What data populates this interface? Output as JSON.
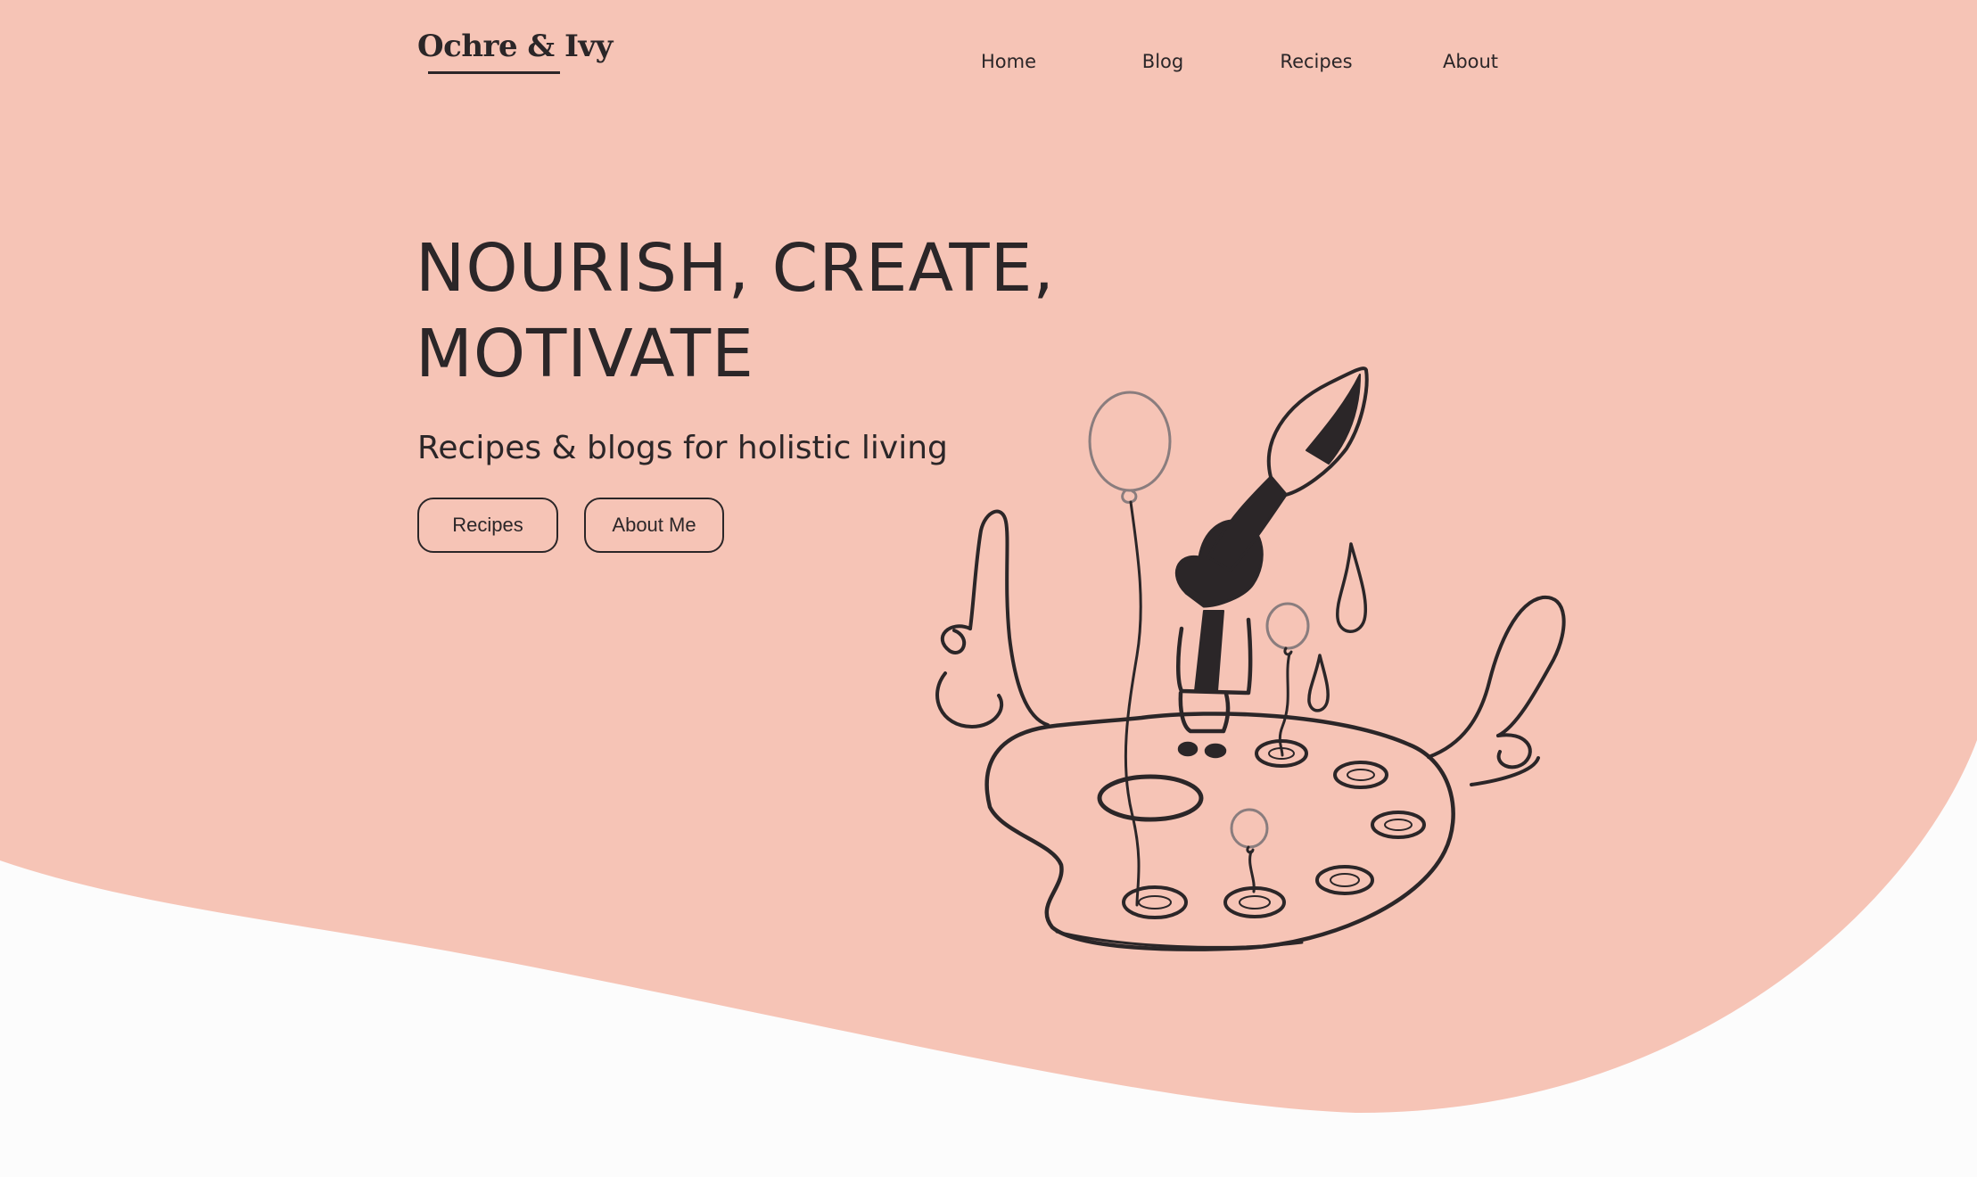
{
  "brand": {
    "logo_text": "Ochre & Ivy"
  },
  "nav": {
    "items": [
      {
        "label": "Home"
      },
      {
        "label": "Blog"
      },
      {
        "label": "Recipes"
      },
      {
        "label": "About"
      }
    ]
  },
  "hero": {
    "title_line1": "NOURISH, CREATE,",
    "title_line2": "MOTIVATE",
    "subtitle": "Recipes & blogs for holistic living",
    "buttons": [
      {
        "label": "Recipes"
      },
      {
        "label": "About Me"
      }
    ]
  },
  "colors": {
    "background_blob": "#f6c4b6",
    "page_background": "#fcfcfc",
    "text": "#2b2628"
  },
  "illustration": {
    "icon": "paintbrush-palette-balloons-illustration"
  }
}
